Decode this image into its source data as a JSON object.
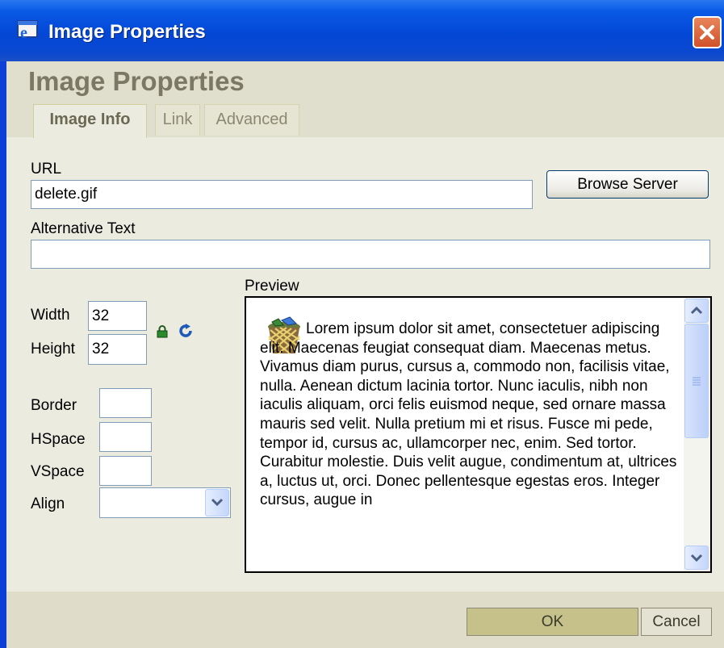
{
  "window": {
    "title": "Image Properties",
    "close_icon": "close-icon"
  },
  "dialog": {
    "heading": "Image Properties"
  },
  "tabs": [
    {
      "label": "Image Info",
      "active": true
    },
    {
      "label": "Link",
      "active": false
    },
    {
      "label": "Advanced",
      "active": false
    }
  ],
  "form": {
    "url_label": "URL",
    "url_value": "delete.gif",
    "browse_label": "Browse Server",
    "alt_label": "Alternative Text",
    "alt_value": "",
    "width_label": "Width",
    "width_value": "32",
    "height_label": "Height",
    "height_value": "32",
    "border_label": "Border",
    "border_value": "",
    "hspace_label": "HSpace",
    "hspace_value": "",
    "vspace_label": "VSpace",
    "vspace_value": "",
    "align_label": "Align",
    "align_value": ""
  },
  "preview": {
    "label": "Preview",
    "image_icon": "recycle-bin-icon",
    "text": "Lorem ipsum dolor sit amet, consectetuer adipiscing elit. Maecenas feugiat consequat diam. Maecenas metus. Vivamus diam purus, cursus a, commodo non, facilisis vitae, nulla. Aenean dictum lacinia tortor. Nunc iaculis, nibh non iaculis aliquam, orci felis euismod neque, sed ornare massa mauris sed velit. Nulla pretium mi et risus. Fusce mi pede, tempor id, cursus ac, ullamcorper nec, enim. Sed tortor. Curabitur molestie. Duis velit augue, condimentum at, ultrices a, luctus ut, orci. Donec pellentesque egestas eros. Integer cursus, augue in"
  },
  "buttons": {
    "ok": "OK",
    "cancel": "Cancel"
  },
  "colors": {
    "titlebar": "#0347d6",
    "dialog_bg": "#ecebdf",
    "heading": "#7b7865",
    "ok_bg": "#c6c18b"
  }
}
